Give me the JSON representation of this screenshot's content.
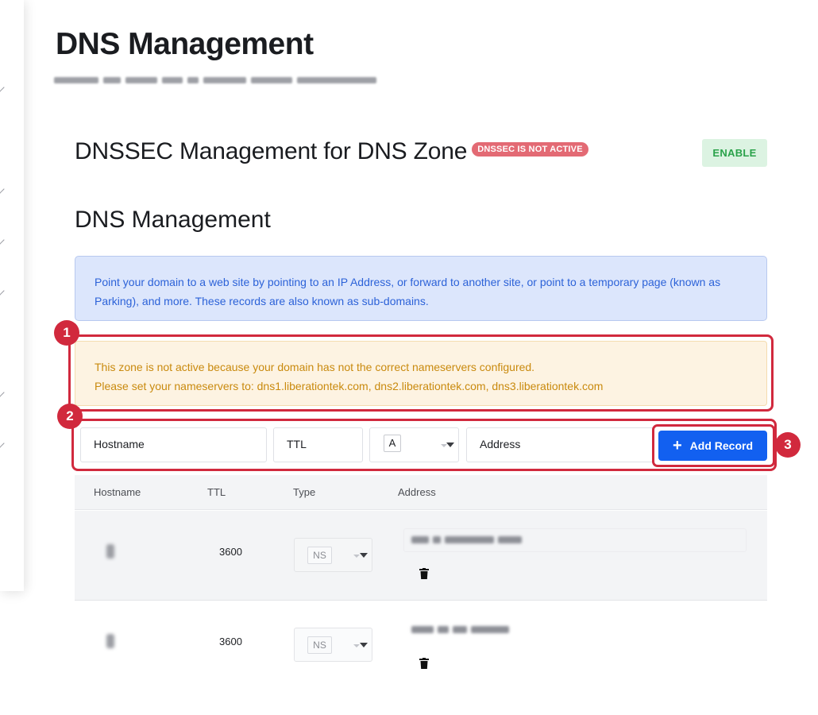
{
  "page": {
    "title": "DNS Management"
  },
  "dnssec": {
    "title": "DNSSEC Management for DNS Zone",
    "status_badge": "DNSSEC IS NOT ACTIVE",
    "enable_label": "ENABLE"
  },
  "dns": {
    "subtitle": "DNS Management",
    "info_text": "Point your domain to a web site by pointing to an IP Address, or forward to another site, or point to a temporary page (known as Parking), and more. These records are also known as sub-domains.",
    "warning_line1": "This zone is not active because your domain has not the correct nameservers configured.",
    "warning_line2": "Please set your nameservers to: dns1.liberationtek.com, dns2.liberationtek.com, dns3.liberationtek.com"
  },
  "form": {
    "hostname_placeholder": "Hostname",
    "ttl_placeholder": "TTL",
    "type_value": "A",
    "address_placeholder": "Address",
    "add_label": "Add Record"
  },
  "table": {
    "headers": [
      "Hostname",
      "TTL",
      "Type",
      "Address"
    ],
    "rows": [
      {
        "ttl": "3600",
        "type": "NS"
      },
      {
        "ttl": "3600",
        "type": "NS"
      }
    ]
  },
  "markers": [
    "1",
    "2",
    "3"
  ],
  "colors": {
    "annotation_red": "#d1293d",
    "primary_blue": "#1260f0",
    "enable_green": "#2aa24a",
    "badge_red": "#e36a74",
    "info_bg": "#dce6fc",
    "warning_bg": "#fdf3e2"
  },
  "icons": [
    "plus-icon",
    "trash-icon",
    "chevron-down-icon"
  ]
}
